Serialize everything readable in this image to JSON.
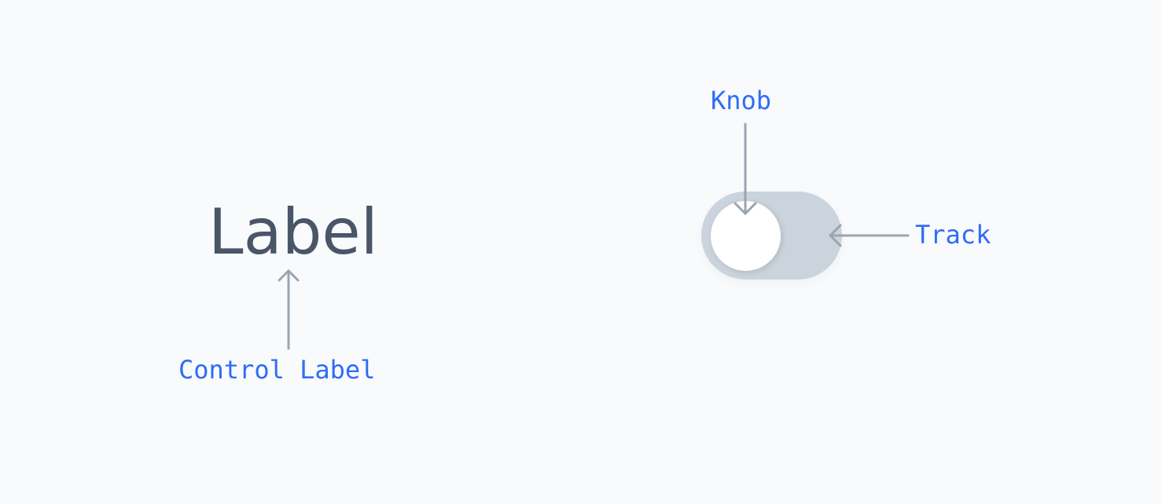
{
  "control_label": "Label",
  "annotations": {
    "control_label": "Control Label",
    "knob": "Knob",
    "track": "Track"
  },
  "toggle": {
    "state": "off"
  },
  "colors": {
    "annotation_text": "#2f6cf6",
    "arrow": "#9aa5b1",
    "track": "#cbd3dd",
    "knob": "#ffffff",
    "label": "#4a5568"
  }
}
